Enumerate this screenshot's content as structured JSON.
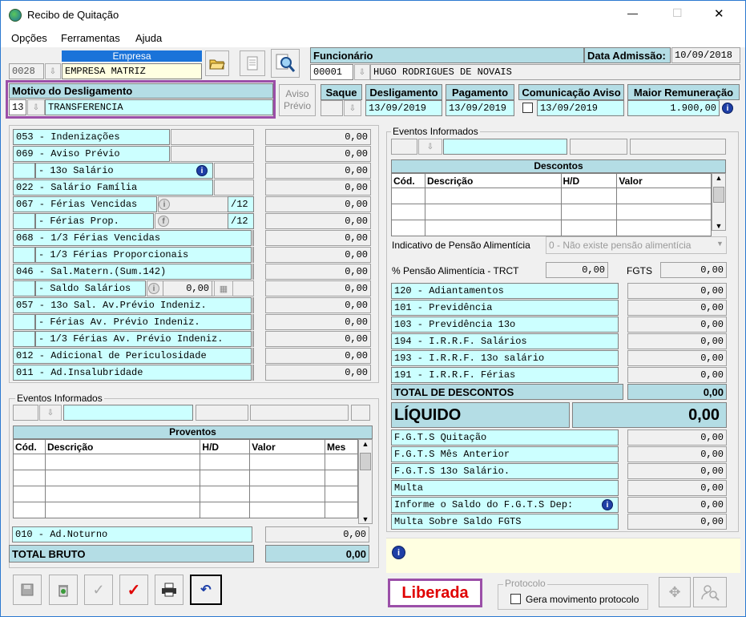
{
  "window": {
    "title": "Recibo de Quitação",
    "minimize": "—",
    "maximize": "☐",
    "close": "✕"
  },
  "menu": [
    "Opções",
    "Ferramentas",
    "Ajuda"
  ],
  "empresa": {
    "label": "Empresa",
    "code": "0028",
    "name": "EMPRESA MATRIZ"
  },
  "funcionario": {
    "label": "Funcionário",
    "code": "00001",
    "name": "HUGO RODRIGUES DE NOVAIS",
    "admissao_label": "Data Admissão:",
    "admissao": "10/09/2018"
  },
  "motivo": {
    "label": "Motivo do Desligamento",
    "code": "13",
    "name": "TRANSFERENCIA"
  },
  "aviso_previo": {
    "line1": "Aviso",
    "line2": "Prévio"
  },
  "saque": {
    "label": "Saque"
  },
  "desligamento": {
    "label": "Desligamento",
    "value": "13/09/2019"
  },
  "pagamento": {
    "label": "Pagamento",
    "value": "13/09/2019"
  },
  "comunicacao": {
    "label": "Comunicação Aviso",
    "value": "13/09/2019"
  },
  "maior_rem": {
    "label": "Maior Remuneração",
    "value": "1.900,00"
  },
  "left_rows": [
    {
      "label": "053 - Indenizações",
      "value": "0,00"
    },
    {
      "label": "069 - Aviso Prévio",
      "value": "0,00"
    },
    {
      "label": "- 13o Salário",
      "value": "0,00"
    },
    {
      "label": "022 - Salário Família",
      "value": "0,00"
    },
    {
      "label": "067 - Férias Vencidas",
      "value": "0,00",
      "suffix": "/12"
    },
    {
      "label": "- Férias Prop.",
      "value": "0,00",
      "suffix": "/12"
    },
    {
      "label": "068 - 1/3 Férias Vencidas",
      "value": "0,00"
    },
    {
      "label": "- 1/3 Férias Proporcionais",
      "value": "0,00"
    },
    {
      "label": "046 - Sal.Matern.(Sum.142)",
      "value": "0,00"
    },
    {
      "label": "- Saldo Salários",
      "value": "0,00",
      "inner": "0,00"
    },
    {
      "label": "057 - 13o Sal. Av.Prévio Indeniz.",
      "value": "0,00"
    },
    {
      "label": "- Férias  Av. Prévio Indeniz.",
      "value": "0,00"
    },
    {
      "label": "- 1/3 Férias Av. Prévio Indeniz.",
      "value": "0,00"
    },
    {
      "label": "012 - Adicional de Periculosidade",
      "value": "0,00"
    },
    {
      "label": "011 - Ad.Insalubridade",
      "value": "0,00"
    }
  ],
  "eventos_left": {
    "label": "Eventos Informados"
  },
  "proventos": {
    "title": "Proventos",
    "cols": [
      "Cód.",
      "Descrição",
      "H/D",
      "Valor",
      "Mes"
    ]
  },
  "ad_noturno": {
    "label": "010 - Ad.Noturno",
    "value": "0,00"
  },
  "total_bruto": {
    "label": "TOTAL BRUTO",
    "value": "0,00"
  },
  "eventos_right": {
    "label": "Eventos Informados"
  },
  "descontos": {
    "title": "Descontos",
    "cols": [
      "Cód.",
      "Descrição",
      "H/D",
      "Valor"
    ]
  },
  "pensao": {
    "label": "Indicativo de Pensão Alimentícia",
    "value": "0 - Não existe pensão alimentícia",
    "pct_label": "% Pensão Alimentícia - TRCT",
    "pct": "0,00",
    "fgts_label": "FGTS",
    "fgts": "0,00"
  },
  "right_rows": [
    {
      "label": "120 - Adiantamentos",
      "value": "0,00"
    },
    {
      "label": "101 - Previdência",
      "value": "0,00"
    },
    {
      "label": "103 - Previdência 13o",
      "value": "0,00"
    },
    {
      "label": "194 - I.R.R.F. Salários",
      "value": "0,00"
    },
    {
      "label": "193 - I.R.R.F. 13o salário",
      "value": "0,00"
    },
    {
      "label": "191 - I.R.R.F. Férias",
      "value": "0,00"
    }
  ],
  "total_descontos": {
    "label": "TOTAL DE DESCONTOS",
    "value": "0,00"
  },
  "liquido": {
    "label": "LÍQUIDO",
    "value": "0,00"
  },
  "fgts_rows": [
    {
      "label": "F.G.T.S  Quitação",
      "value": "0,00"
    },
    {
      "label": "F.G.T.S  Mês Anterior",
      "value": "0,00"
    },
    {
      "label": "F.G.T.S  13o Salário.",
      "value": "0,00"
    },
    {
      "label": "Multa",
      "value": "0,00"
    },
    {
      "label": "Informe o Saldo do F.G.T.S Dep:",
      "value": "0,00"
    },
    {
      "label": "Multa Sobre Saldo FGTS",
      "value": "0,00"
    }
  ],
  "status": {
    "label": "Liberada",
    "color": "#e00000"
  },
  "protocolo": {
    "label": "Protocolo",
    "checkbox": "Gera movimento protocolo"
  },
  "colors": {
    "cyan": "#ccffff",
    "header": "#b4dde5",
    "purple": "#9b4fa8",
    "info_bar": "#ffffe1"
  }
}
